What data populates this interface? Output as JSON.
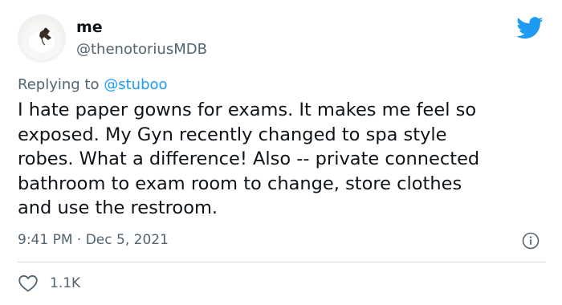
{
  "author": {
    "display_name": "me",
    "handle": "@thenotoriusMDB"
  },
  "reply": {
    "prefix": "Replying to",
    "mention": "@stuboo"
  },
  "tweet": {
    "lines": [
      "I hate paper gowns for exams. It makes me feel so",
      "exposed. My Gyn recently changed to spa style",
      "robes. What a difference! Also -- private connected",
      "bathroom to exam room to change, store clothes",
      "and use the restroom."
    ],
    "time": "9:41 PM",
    "separator": "·",
    "date": "Dec 5, 2021"
  },
  "engagement": {
    "likes": "1.1K"
  },
  "icons": {
    "brand": "twitter-bird-icon",
    "info": "info-icon",
    "like": "heart-icon"
  },
  "colors": {
    "brand_blue": "#1d9bf0",
    "secondary_text": "#536471",
    "primary_text": "#0f1419",
    "divider": "#cfd9de"
  }
}
